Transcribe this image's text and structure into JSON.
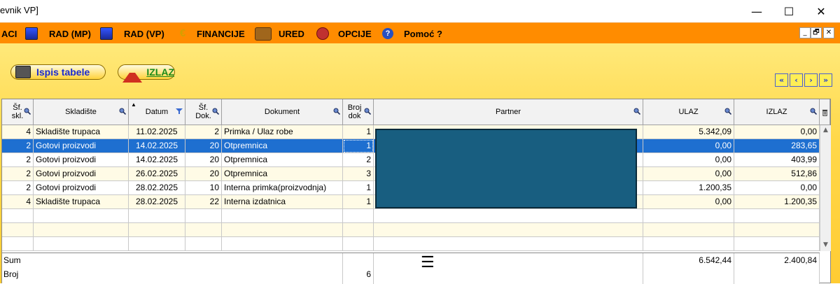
{
  "window": {
    "title": "evnik VP]",
    "min_glyph": "—",
    "max_glyph": "☐",
    "close_glyph": "✕"
  },
  "menu": {
    "items": [
      {
        "label": "ACI",
        "icon": "none"
      },
      {
        "label": "RAD (MP)",
        "icon": "pc-icon"
      },
      {
        "label": "RAD (VP)",
        "icon": "pc-icon"
      },
      {
        "label": "FINANCIJE",
        "icon": "euro-icon"
      },
      {
        "label": "URED",
        "icon": "briefcase-icon"
      },
      {
        "label": "OPCIJE",
        "icon": "options-icon"
      },
      {
        "label": "Pomoć ?",
        "icon": "help-icon"
      }
    ],
    "mdi": {
      "min": "_",
      "restore": "🗗",
      "close": "✕"
    }
  },
  "toolbar": {
    "print_label": "Ispis tabele",
    "exit_label": "IZLAZ",
    "nav": [
      "«",
      "‹",
      "›",
      "»"
    ]
  },
  "colors": {
    "menu_bg": "#ff8c00",
    "selection": "#1e6fd0",
    "mask": "#185e80",
    "button_text": "#1b2bd0"
  },
  "table": {
    "headers": {
      "sklad_code": "Šf. skl.",
      "sklad": "Skladište",
      "datum": "Datum",
      "dok_code": "Šf. Dok.",
      "dokument": "Dokument",
      "broj": "Broj dok",
      "partner": "Partner",
      "ulaz": "ULAZ",
      "izlaz": "IZLAZ"
    },
    "rows": [
      {
        "sifra_skl": "4",
        "skladiste": "Skladište trupaca",
        "datum": "11.02.2025",
        "sifra_dok": "2",
        "dokument": "Primka / Ulaz robe",
        "broj": "1",
        "ulaz": "5.342,09",
        "izlaz": "0,00"
      },
      {
        "sifra_skl": "2",
        "skladiste": "Gotovi proizvodi",
        "datum": "14.02.2025",
        "sifra_dok": "20",
        "dokument": "Otpremnica",
        "broj": "1",
        "ulaz": "0,00",
        "izlaz": "283,65"
      },
      {
        "sifra_skl": "2",
        "skladiste": "Gotovi proizvodi",
        "datum": "14.02.2025",
        "sifra_dok": "20",
        "dokument": "Otpremnica",
        "broj": "2",
        "ulaz": "0,00",
        "izlaz": "403,99"
      },
      {
        "sifra_skl": "2",
        "skladiste": "Gotovi proizvodi",
        "datum": "26.02.2025",
        "sifra_dok": "20",
        "dokument": "Otpremnica",
        "broj": "3",
        "ulaz": "0,00",
        "izlaz": "512,86"
      },
      {
        "sifra_skl": "2",
        "skladiste": "Gotovi proizvodi",
        "datum": "28.02.2025",
        "sifra_dok": "10",
        "dokument": "Interna primka(proizvodnja)",
        "broj": "1",
        "ulaz": "1.200,35",
        "izlaz": "0,00"
      },
      {
        "sifra_skl": "4",
        "skladiste": "Skladište trupaca",
        "datum": "28.02.2025",
        "sifra_dok": "22",
        "dokument": "Interna izdatnica",
        "broj": "1",
        "ulaz": "0,00",
        "izlaz": "1.200,35"
      }
    ],
    "selected_row": 1
  },
  "footer": {
    "sum_label": "Sum",
    "count_label": "Broj",
    "count_value": "6",
    "menu_glyph": "☰",
    "sum_ulaz": "6.542,44",
    "sum_izlaz": "2.400,84"
  }
}
